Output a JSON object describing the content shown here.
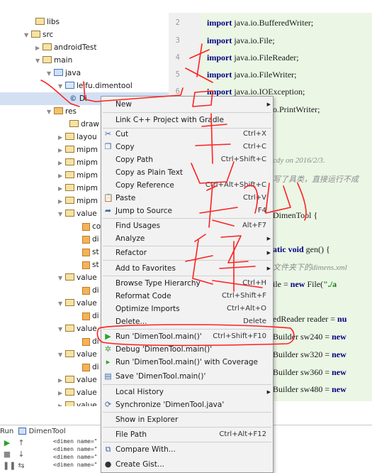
{
  "tree": {
    "items": [
      {
        "label": "libs"
      },
      {
        "label": "src"
      },
      {
        "label": "androidTest"
      },
      {
        "label": "main"
      },
      {
        "label": "java"
      },
      {
        "label": "leifu.dimentool"
      },
      {
        "label": "Di"
      },
      {
        "label": "res"
      },
      {
        "label": "draw"
      },
      {
        "label": "layou"
      },
      {
        "label": "mipm"
      },
      {
        "label": "mipm"
      },
      {
        "label": "mipm"
      },
      {
        "label": "mipm"
      },
      {
        "label": "mipm"
      },
      {
        "label": "value"
      },
      {
        "label": "co"
      },
      {
        "label": "di"
      },
      {
        "label": "st"
      },
      {
        "label": "st"
      },
      {
        "label": "value"
      },
      {
        "label": "di"
      },
      {
        "label": "value"
      },
      {
        "label": "di"
      },
      {
        "label": "value"
      },
      {
        "label": "di"
      },
      {
        "label": "value"
      },
      {
        "label": "di"
      },
      {
        "label": "value"
      },
      {
        "label": "value"
      },
      {
        "label": "value"
      }
    ]
  },
  "editor": {
    "line_numbers": [
      "2",
      "3",
      "4",
      "5",
      "6"
    ],
    "lines": [
      {
        "kw": "import",
        "rest": " java.io.BufferedWriter;"
      },
      {
        "kw": "import",
        "rest": " java.io.File;"
      },
      {
        "kw": "import",
        "rest": " java.io.FileReader;"
      },
      {
        "kw": "import",
        "rest": " java.io.FileWriter;"
      },
      {
        "kw": "import",
        "rest": " java.io.IOException;"
      }
    ],
    "l_print": "o.PrintWriter;",
    "comment1": "cdy on 2016/2/3.",
    "comment2": "写了具类，直接运行不成",
    "class_decl": "DimenTool {",
    "method_kw": "atic void",
    "method_rest": " gen() {",
    "comment3": "文件夹下的dimens.xml",
    "file_pre": "ile = ",
    "file_kw": "new",
    "file_post": " File(",
    "file_str": "\"./a",
    "reader": "edReader reader = ",
    "reader_kw": "nu",
    "sb_lines": [
      {
        "pre": "Builder sw240 = ",
        "kw": "new"
      },
      {
        "pre": "Builder sw320 = ",
        "kw": "new"
      },
      {
        "pre": "Builder sw360 = ",
        "kw": "new"
      },
      {
        "pre": "Builder sw480 = ",
        "kw": "new"
      }
    ]
  },
  "run_panel": {
    "tab_run": "Run",
    "tab_config": "DimenTool",
    "output": [
      "<dimen name=\"",
      "<dimen name=\"",
      "<dimen name=\"",
      "<dimen name=\""
    ]
  },
  "context_menu": {
    "items": [
      {
        "label": "New",
        "shortcut": "",
        "submenu": true,
        "icon": ""
      },
      {
        "label": "Link C++ Project with Gradle",
        "shortcut": "",
        "submenu": false,
        "icon": ""
      },
      {
        "label": "Cut",
        "shortcut": "Ctrl+X",
        "submenu": false,
        "icon": "scissors-icon"
      },
      {
        "label": "Copy",
        "shortcut": "Ctrl+C",
        "submenu": false,
        "icon": "copy-icon"
      },
      {
        "label": "Copy Path",
        "shortcut": "Ctrl+Shift+C",
        "submenu": false,
        "icon": ""
      },
      {
        "label": "Copy as Plain Text",
        "shortcut": "",
        "submenu": false,
        "icon": ""
      },
      {
        "label": "Copy Reference",
        "shortcut": "Ctrl+Alt+Shift+C",
        "submenu": false,
        "icon": ""
      },
      {
        "label": "Paste",
        "shortcut": "Ctrl+V",
        "submenu": false,
        "icon": "paste-icon"
      },
      {
        "label": "Jump to Source",
        "shortcut": "F4",
        "submenu": false,
        "icon": "jump-icon"
      },
      {
        "label": "Find Usages",
        "shortcut": "Alt+F7",
        "submenu": false,
        "icon": ""
      },
      {
        "label": "Analyze",
        "shortcut": "",
        "submenu": true,
        "icon": ""
      },
      {
        "label": "Refactor",
        "shortcut": "",
        "submenu": true,
        "icon": ""
      },
      {
        "label": "Add to Favorites",
        "shortcut": "",
        "submenu": true,
        "icon": ""
      },
      {
        "label": "Browse Type Hierarchy",
        "shortcut": "Ctrl+H",
        "submenu": false,
        "icon": ""
      },
      {
        "label": "Reformat Code",
        "shortcut": "Ctrl+Shift+F",
        "submenu": false,
        "icon": ""
      },
      {
        "label": "Optimize Imports",
        "shortcut": "Ctrl+Alt+O",
        "submenu": false,
        "icon": ""
      },
      {
        "label": "Delete...",
        "shortcut": "Delete",
        "submenu": false,
        "icon": ""
      },
      {
        "label": "Run 'DimenTool.main()'",
        "shortcut": "Ctrl+Shift+F10",
        "submenu": false,
        "icon": "run-icon"
      },
      {
        "label": "Debug 'DimenTool.main()'",
        "shortcut": "",
        "submenu": false,
        "icon": "debug-icon"
      },
      {
        "label": "Run 'DimenTool.main()' with Coverage",
        "shortcut": "",
        "submenu": false,
        "icon": "coverage-icon"
      },
      {
        "label": "Save 'DimenTool.main()'",
        "shortcut": "",
        "submenu": false,
        "icon": "save-config-icon"
      },
      {
        "label": "Local History",
        "shortcut": "",
        "submenu": true,
        "icon": ""
      },
      {
        "label": "Synchronize 'DimenTool.java'",
        "shortcut": "",
        "submenu": false,
        "icon": "sync-icon"
      },
      {
        "label": "Show in Explorer",
        "shortcut": "",
        "submenu": false,
        "icon": ""
      },
      {
        "label": "File Path",
        "shortcut": "Ctrl+Alt+F12",
        "submenu": false,
        "icon": ""
      },
      {
        "label": "Compare With...",
        "shortcut": "",
        "submenu": false,
        "icon": "compare-icon"
      },
      {
        "label": "Create Gist...",
        "shortcut": "",
        "submenu": false,
        "icon": "github-icon"
      }
    ]
  },
  "annotation": {
    "color": "#ff0000"
  }
}
